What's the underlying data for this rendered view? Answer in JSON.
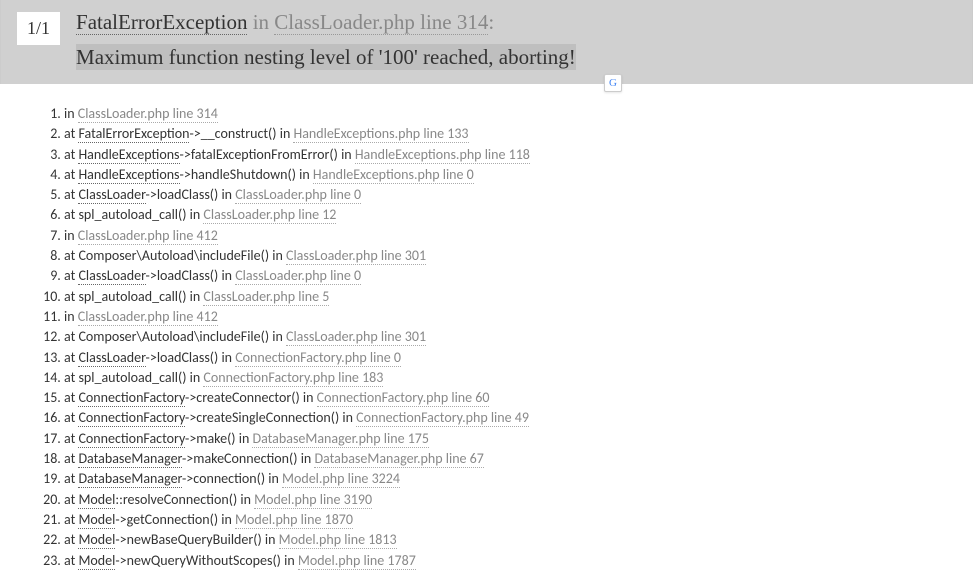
{
  "header": {
    "counter": "1/1",
    "exception_name": "FatalErrorException",
    "in_word": " in ",
    "location": "ClassLoader.php line 314",
    "message": "Maximum function nesting level of '100' reached, aborting!"
  },
  "translate_icon": "G",
  "trace": [
    {
      "prefix": "in",
      "class": "",
      "arrow": "",
      "method": "",
      "location": "ClassLoader.php line 314"
    },
    {
      "prefix": "at",
      "class": "FatalErrorException",
      "arrow": "->",
      "method": "__construct()",
      "in": " in ",
      "location": "HandleExceptions.php line 133"
    },
    {
      "prefix": "at",
      "class": "HandleExceptions",
      "arrow": "->",
      "method": "fatalExceptionFromError()",
      "in": " in ",
      "location": "HandleExceptions.php line 118"
    },
    {
      "prefix": "at",
      "class": "HandleExceptions",
      "arrow": "->",
      "method": "handleShutdown()",
      "in": " in ",
      "location": "HandleExceptions.php line 0"
    },
    {
      "prefix": "at",
      "class": "ClassLoader",
      "arrow": "->",
      "method": "loadClass()",
      "in": " in ",
      "location": "ClassLoader.php line 0"
    },
    {
      "prefix": "at",
      "class": "",
      "arrow": "",
      "method": "spl_autoload_call()",
      "in": " in ",
      "location": "ClassLoader.php line 12"
    },
    {
      "prefix": "in",
      "class": "",
      "arrow": "",
      "method": "",
      "location": "ClassLoader.php line 412"
    },
    {
      "prefix": "at",
      "class": "",
      "arrow": "",
      "method": "Composer\\Autoload\\includeFile()",
      "in": " in ",
      "location": "ClassLoader.php line 301"
    },
    {
      "prefix": "at",
      "class": "ClassLoader",
      "arrow": "->",
      "method": "loadClass()",
      "in": " in ",
      "location": "ClassLoader.php line 0"
    },
    {
      "prefix": "at",
      "class": "",
      "arrow": "",
      "method": "spl_autoload_call()",
      "in": " in ",
      "location": "ClassLoader.php line 5"
    },
    {
      "prefix": "in",
      "class": "",
      "arrow": "",
      "method": "",
      "location": "ClassLoader.php line 412"
    },
    {
      "prefix": "at",
      "class": "",
      "arrow": "",
      "method": "Composer\\Autoload\\includeFile()",
      "in": " in ",
      "location": "ClassLoader.php line 301"
    },
    {
      "prefix": "at",
      "class": "ClassLoader",
      "arrow": "->",
      "method": "loadClass()",
      "in": " in ",
      "location": "ConnectionFactory.php line 0"
    },
    {
      "prefix": "at",
      "class": "",
      "arrow": "",
      "method": "spl_autoload_call()",
      "in": " in ",
      "location": "ConnectionFactory.php line 183"
    },
    {
      "prefix": "at",
      "class": "ConnectionFactory",
      "arrow": "->",
      "method": "createConnector()",
      "in": " in ",
      "location": "ConnectionFactory.php line 60"
    },
    {
      "prefix": "at",
      "class": "ConnectionFactory",
      "arrow": "->",
      "method": "createSingleConnection()",
      "in": " in ",
      "location": "ConnectionFactory.php line 49"
    },
    {
      "prefix": "at",
      "class": "ConnectionFactory",
      "arrow": "->",
      "method": "make()",
      "in": " in ",
      "location": "DatabaseManager.php line 175"
    },
    {
      "prefix": "at",
      "class": "DatabaseManager",
      "arrow": "->",
      "method": "makeConnection()",
      "in": " in ",
      "location": "DatabaseManager.php line 67"
    },
    {
      "prefix": "at",
      "class": "DatabaseManager",
      "arrow": "->",
      "method": "connection()",
      "in": " in ",
      "location": "Model.php line 3224"
    },
    {
      "prefix": "at",
      "class": "Model",
      "arrow": "::",
      "method": "resolveConnection()",
      "in": " in ",
      "location": "Model.php line 3190"
    },
    {
      "prefix": "at",
      "class": "Model",
      "arrow": "->",
      "method": "getConnection()",
      "in": " in ",
      "location": "Model.php line 1870"
    },
    {
      "prefix": "at",
      "class": "Model",
      "arrow": "->",
      "method": "newBaseQueryBuilder()",
      "in": " in ",
      "location": "Model.php line 1813"
    },
    {
      "prefix": "at",
      "class": "Model",
      "arrow": "->",
      "method": "newQueryWithoutScopes()",
      "in": " in ",
      "location": "Model.php line 1787"
    }
  ]
}
